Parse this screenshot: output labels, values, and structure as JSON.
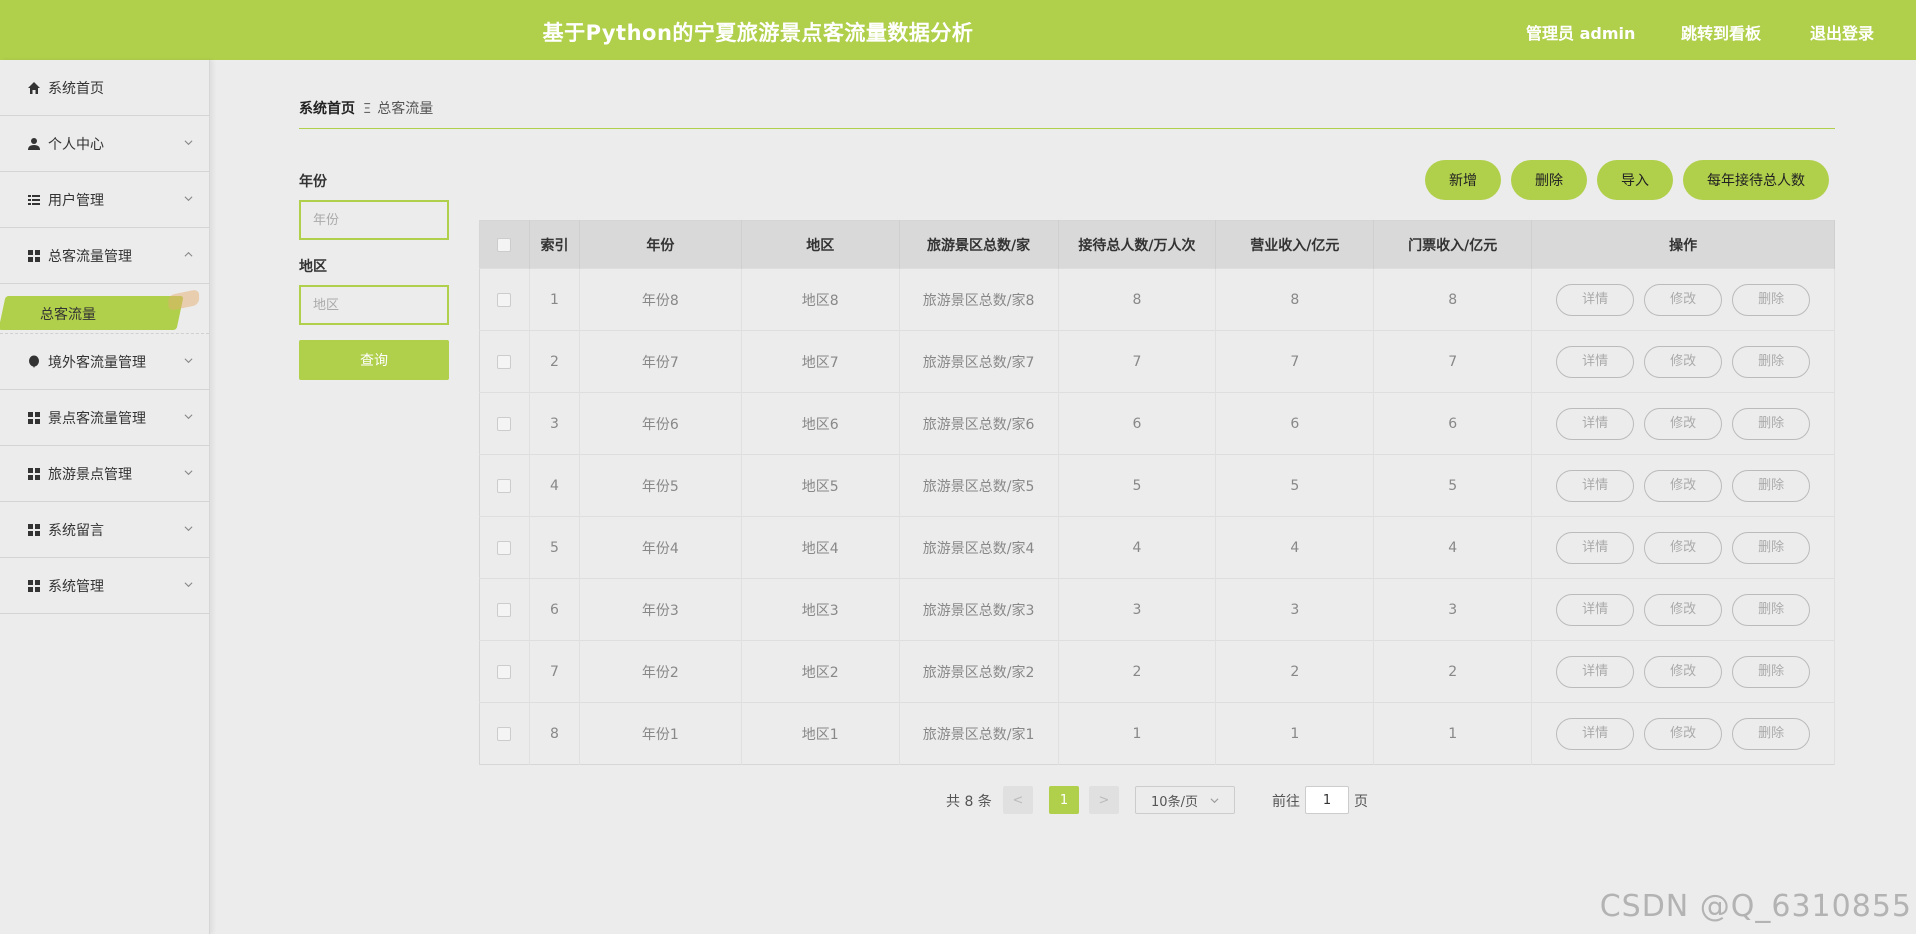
{
  "header": {
    "title": "基于Python的宁夏旅游景点客流量数据分析",
    "user_label": "管理员 admin",
    "dashboard_link": "跳转到看板",
    "logout_link": "退出登录"
  },
  "colors": {
    "accent": "#b0cf4b",
    "background": "#ececec"
  },
  "sidebar": {
    "items": [
      {
        "label": "系统首页",
        "icon": "home-icon"
      },
      {
        "label": "个人中心",
        "icon": "user-icon"
      },
      {
        "label": "用户管理",
        "icon": "list-icon"
      },
      {
        "label": "总客流量管理",
        "icon": "grid-icon",
        "expanded": true
      },
      {
        "label": "境外客流量管理",
        "icon": "balloon-icon"
      },
      {
        "label": "景点客流量管理",
        "icon": "grid-icon"
      },
      {
        "label": "旅游景点管理",
        "icon": "grid-icon"
      },
      {
        "label": "系统留言",
        "icon": "grid-icon"
      },
      {
        "label": "系统管理",
        "icon": "grid-icon"
      }
    ],
    "active_sub": "总客流量"
  },
  "breadcrumb": {
    "home": "系统首页",
    "separator": "Ξ",
    "current": "总客流量"
  },
  "search": {
    "year_label": "年份",
    "year_placeholder": "年份",
    "region_label": "地区",
    "region_placeholder": "地区",
    "query_button": "查询"
  },
  "actions": {
    "add": "新增",
    "delete": "删除",
    "import": "导入",
    "yearly": "每年接待总人数"
  },
  "table": {
    "columns": [
      "索引",
      "年份",
      "地区",
      "旅游景区总数/家",
      "接待总人数/万人次",
      "营业收入/亿元",
      "门票收入/亿元",
      "操作"
    ],
    "rows": [
      [
        "1",
        "年份8",
        "地区8",
        "旅游景区总数/家8",
        "8",
        "8",
        "8"
      ],
      [
        "2",
        "年份7",
        "地区7",
        "旅游景区总数/家7",
        "7",
        "7",
        "7"
      ],
      [
        "3",
        "年份6",
        "地区6",
        "旅游景区总数/家6",
        "6",
        "6",
        "6"
      ],
      [
        "4",
        "年份5",
        "地区5",
        "旅游景区总数/家5",
        "5",
        "5",
        "5"
      ],
      [
        "5",
        "年份4",
        "地区4",
        "旅游景区总数/家4",
        "4",
        "4",
        "4"
      ],
      [
        "6",
        "年份3",
        "地区3",
        "旅游景区总数/家3",
        "3",
        "3",
        "3"
      ],
      [
        "7",
        "年份2",
        "地区2",
        "旅游景区总数/家2",
        "2",
        "2",
        "2"
      ],
      [
        "8",
        "年份1",
        "地区1",
        "旅游景区总数/家1",
        "1",
        "1",
        "1"
      ]
    ],
    "row_buttons": {
      "detail": "详情",
      "edit": "修改",
      "delete": "删除"
    }
  },
  "pagination": {
    "total": "共 8 条",
    "prev": "<",
    "current_page": "1",
    "next": ">",
    "page_size": "10条/页",
    "goto_prefix": "前往",
    "goto_value": "1",
    "goto_suffix": "页"
  },
  "watermark": "CSDN @Q_6310855"
}
